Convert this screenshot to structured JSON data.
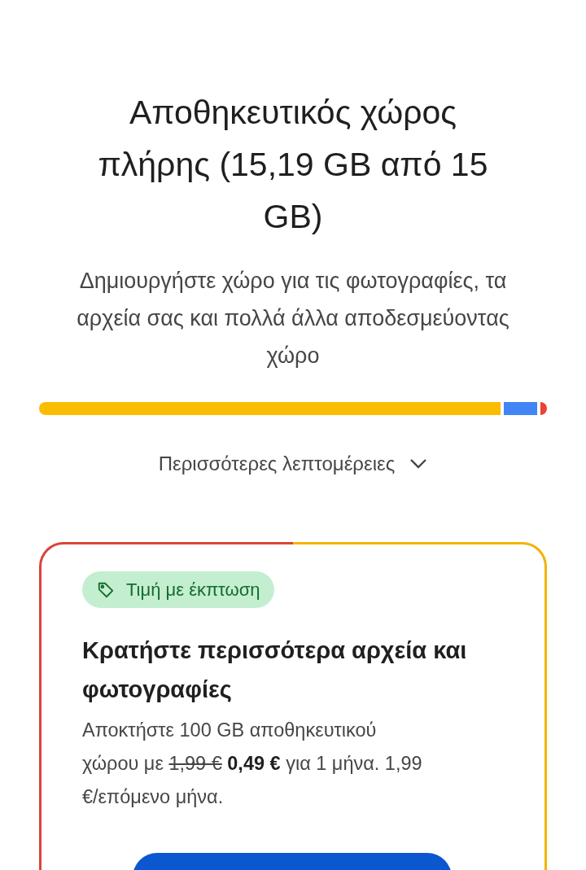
{
  "title": "Αποθηκευτικός χώρος πλήρης (15,19 GB από 15 GB)",
  "subtitle": "Δημιουργήστε χώρο για τις φωτογραφίες, τα αρχεία σας και πολλά άλλα αποδεσμεύοντας χώρο",
  "storage_bar": [
    {
      "color": "#fbbc04"
    },
    {
      "color": "#4285f4"
    },
    {
      "color": "#ea4335"
    }
  ],
  "details_toggle": {
    "label": "Περισσότερες λεπτομέρειες",
    "expanded": false
  },
  "offer": {
    "badge": "Τιμή με έκπτωση",
    "heading": "Κρατήστε περισσότερα αρχεία και φωτογραφίες",
    "description": [
      {
        "kind": "plain",
        "text": "Αποκτήστε 100 GB αποθηκευτικού χώρου με "
      },
      {
        "kind": "struck",
        "text": "1,99 €"
      },
      {
        "kind": "bold",
        "text": " 0,49 €"
      },
      {
        "kind": "plain",
        "text": " για 1 μήνα. 1,99 €/επόμενο μήνα."
      }
    ]
  }
}
